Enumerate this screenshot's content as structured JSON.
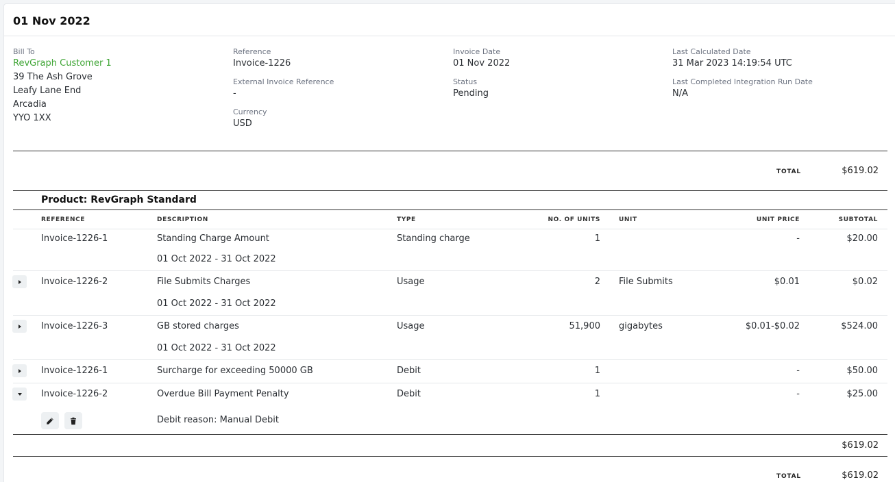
{
  "header": {
    "title": "01 Nov 2022"
  },
  "details": {
    "bill_to_label": "Bill To",
    "customer_name": "RevGraph Customer 1",
    "address": [
      "39 The Ash Grove",
      "Leafy Lane End",
      "Arcadia",
      "YYO 1XX"
    ],
    "reference_label": "Reference",
    "reference": "Invoice-1226",
    "external_reference_label": "External Invoice Reference",
    "external_reference": "-",
    "currency_label": "Currency",
    "currency": "USD",
    "invoice_date_label": "Invoice Date",
    "invoice_date": "01 Nov 2022",
    "status_label": "Status",
    "status": "Pending",
    "last_calculated_label": "Last Calculated Date",
    "last_calculated": "31 Mar 2023 14:19:54 UTC",
    "last_integration_label": "Last Completed Integration Run Date",
    "last_integration": "N/A"
  },
  "totals": {
    "label": "TOTAL",
    "top_value": "$619.02",
    "subtotal_value": "$619.02",
    "bottom_value": "$619.02"
  },
  "product": {
    "title": "Product: RevGraph Standard"
  },
  "columns": {
    "reference": "REFERENCE",
    "description": "DESCRIPTION",
    "type": "TYPE",
    "units": "NO. OF UNITS",
    "unit": "UNIT",
    "unit_price": "UNIT PRICE",
    "subtotal": "SUBTOTAL"
  },
  "rows": [
    {
      "reference": "Invoice-1226-1",
      "description": "Standing Charge Amount",
      "period": "01 Oct 2022 - 31 Oct 2022",
      "type": "Standing charge",
      "units": "1",
      "unit": "",
      "unit_price": "-",
      "subtotal": "$20.00"
    },
    {
      "reference": "Invoice-1226-2",
      "description": "File Submits Charges",
      "period": "01 Oct 2022 - 31 Oct 2022",
      "type": "Usage",
      "units": "2",
      "unit": "File Submits",
      "unit_price": "$0.01",
      "subtotal": "$0.02"
    },
    {
      "reference": "Invoice-1226-3",
      "description": "GB stored charges",
      "period": "01 Oct 2022 - 31 Oct 2022",
      "type": "Usage",
      "units": "51,900",
      "unit": "gigabytes",
      "unit_price": "$0.01-$0.02",
      "subtotal": "$524.00"
    },
    {
      "reference": "Invoice-1226-1",
      "description": "Surcharge for exceeding 50000 GB",
      "type": "Debit",
      "units": "1",
      "unit": "",
      "unit_price": "-",
      "subtotal": "$50.00"
    },
    {
      "reference": "Invoice-1226-2",
      "description": "Overdue Bill Payment Penalty",
      "type": "Debit",
      "units": "1",
      "unit": "",
      "unit_price": "-",
      "subtotal": "$25.00",
      "debit_reason": "Debit reason: Manual Debit"
    }
  ],
  "icons": {
    "expand": "caret-right-icon",
    "collapse": "caret-down-icon",
    "edit": "pencil-icon",
    "delete": "trash-icon"
  }
}
